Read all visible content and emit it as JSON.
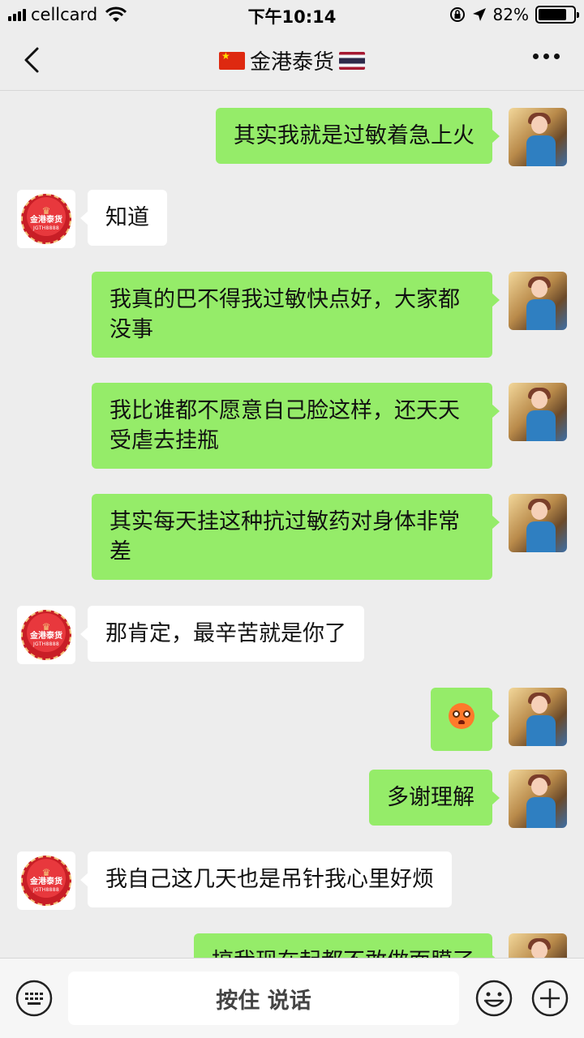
{
  "status_bar": {
    "carrier": "cellcard",
    "time": "下午10:14",
    "battery_percent": "82%",
    "battery_level": 0.82
  },
  "nav": {
    "title": "金港泰货",
    "back_icon": "chevron-left-icon",
    "more_icon": "more-dots-icon"
  },
  "brand_avatar": {
    "name": "金港泰货",
    "id": "JGTH8888"
  },
  "messages": [
    {
      "side": "right",
      "text": "其实我就是过敏着急上火"
    },
    {
      "side": "left",
      "text": "知道"
    },
    {
      "side": "right",
      "text": "我真的巴不得我过敏快点好，大家都没事"
    },
    {
      "side": "right",
      "text": "我比谁都不愿意自己脸这样，还天天受虐去挂瓶"
    },
    {
      "side": "right",
      "text": "其实每天挂这种抗过敏药对身体非常差"
    },
    {
      "side": "left",
      "text": "那肯定，最辛苦就是你了"
    },
    {
      "side": "right",
      "type": "emoji",
      "emoji": "flushed-face-emoji"
    },
    {
      "side": "right",
      "text": "多谢理解"
    },
    {
      "side": "left",
      "text": "我自己这几天也是吊针我心里好烦"
    },
    {
      "side": "right",
      "text": "搞我现在起都不敢做面膜了"
    }
  ],
  "input_bar": {
    "voice_label": "按住 说话",
    "keyboard_icon": "keyboard-icon",
    "emoji_icon": "emoji-icon",
    "add_icon": "plus-circle-icon"
  }
}
